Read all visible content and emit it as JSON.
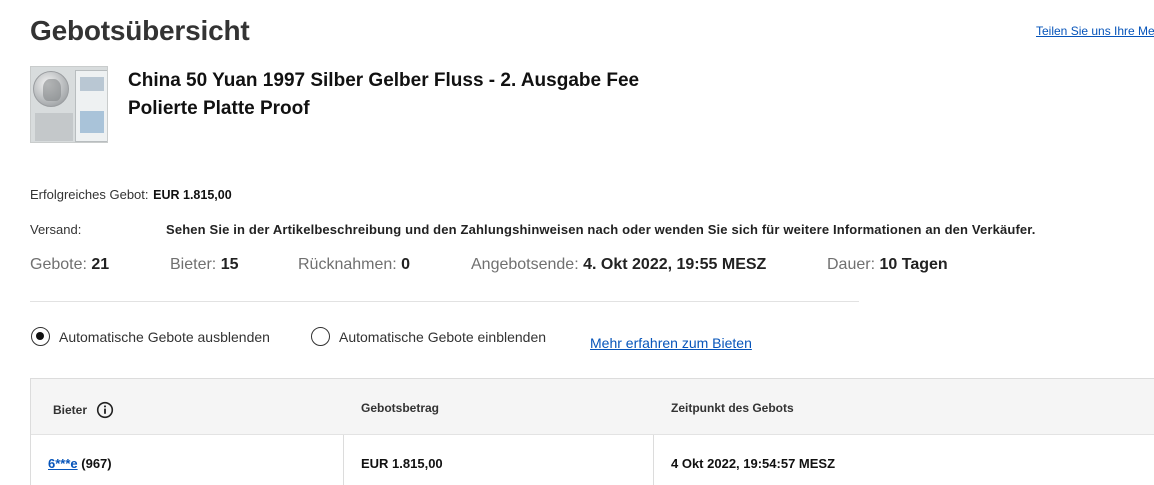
{
  "page": {
    "title": "Gebotsübersicht",
    "share_link": "Teilen Sie uns Ihre Me"
  },
  "item": {
    "title_line1": "China 50 Yuan 1997 Silber Gelber Fluss - 2. Ausgabe Fee",
    "title_line2": "Polierte Platte Proof"
  },
  "summary": {
    "winning_bid_label": "Erfolgreiches Gebot:",
    "winning_bid_value": "EUR 1.815,00",
    "shipping_label": "Versand:",
    "shipping_value": "Sehen Sie in der Artikelbeschreibung und den Zahlungshinweisen nach oder wenden Sie sich für weitere Informationen an den Verkäufer."
  },
  "stats": {
    "bids_label": "Gebote:",
    "bids_value": "21",
    "bidders_label": "Bieter:",
    "bidders_value": "15",
    "retractions_label": "Rücknahmen:",
    "retractions_value": "0",
    "end_label": "Angebotsende:",
    "end_value": "4. Okt 2022, 19:55 MESZ",
    "duration_label": "Dauer:",
    "duration_value": "10 Tagen"
  },
  "options": {
    "hide_auto_label": "Automatische Gebote ausblenden",
    "hide_auto_checked": true,
    "show_auto_label": "Automatische Gebote einblenden",
    "show_auto_checked": false,
    "learn_more": "Mehr erfahren zum Bieten"
  },
  "table": {
    "headers": [
      "Bieter",
      "Gebotsbetrag",
      "Zeitpunkt des Gebots"
    ],
    "header_icon": "info-icon",
    "rows": [
      {
        "bidder": "6***e",
        "feedback": "(967)",
        "amount": "EUR 1.815,00",
        "time": "4 Okt 2022, 19:54:57 MESZ"
      }
    ]
  },
  "colors": {
    "link": "#0654ba",
    "header_bg": "#f5f5f5",
    "text": "#333333"
  }
}
